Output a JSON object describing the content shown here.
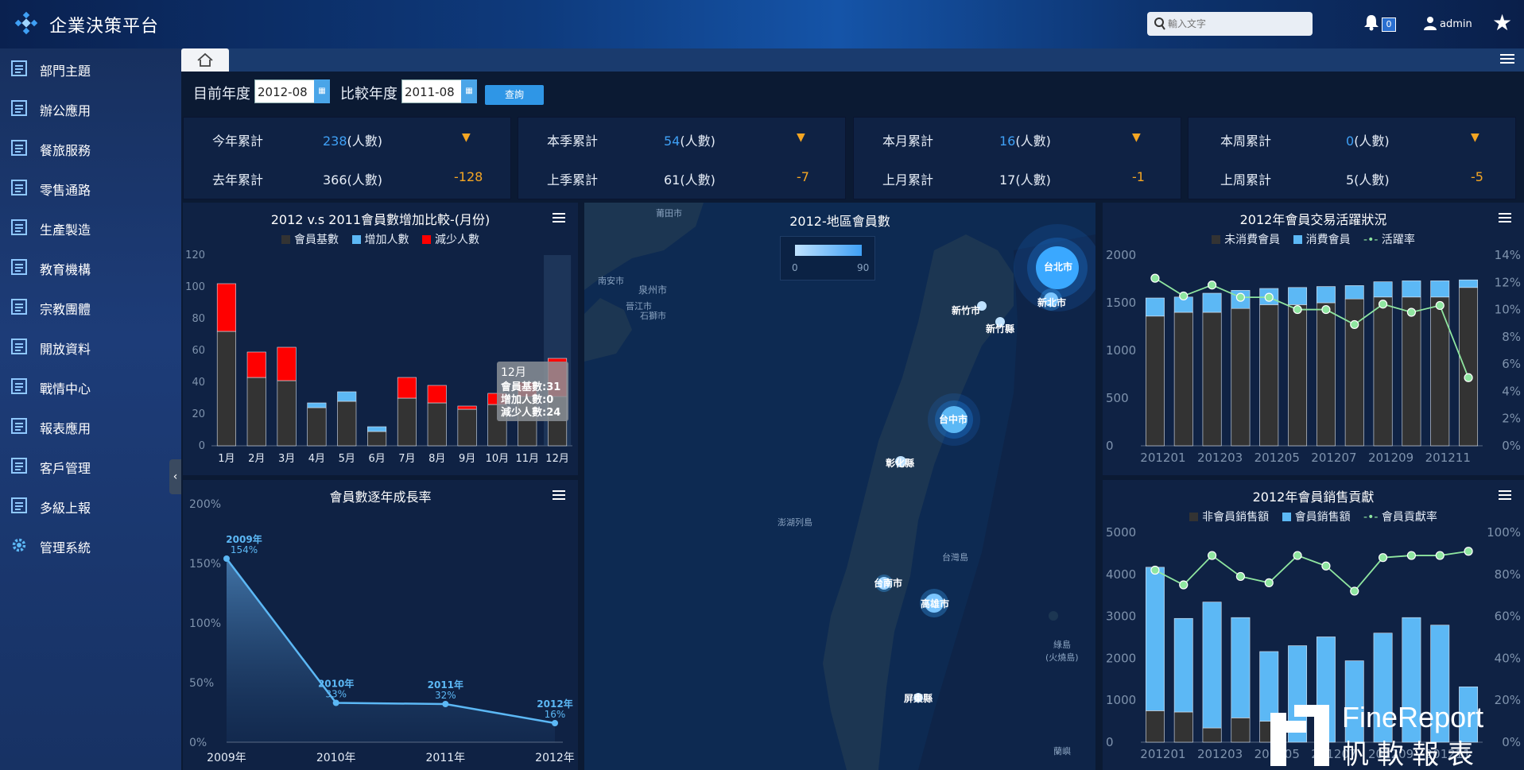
{
  "app": {
    "title": "企業決策平台"
  },
  "header": {
    "search_placeholder": "輸入文字",
    "notif_count": "0",
    "user": "admin"
  },
  "sidebar": {
    "items": [
      {
        "label": "部門主題"
      },
      {
        "label": "辦公應用"
      },
      {
        "label": "餐旅服務"
      },
      {
        "label": "零售通路"
      },
      {
        "label": "生產製造"
      },
      {
        "label": "教育機構"
      },
      {
        "label": "宗教團體"
      },
      {
        "label": "開放資料"
      },
      {
        "label": "戰情中心"
      },
      {
        "label": "報表應用"
      },
      {
        "label": "客戶管理"
      },
      {
        "label": "多級上報"
      },
      {
        "label": "管理系統"
      }
    ]
  },
  "filters": {
    "current_year_label": "目前年度",
    "current_year_value": "2012-08",
    "compare_year_label": "比較年度",
    "compare_year_value": "2011-08",
    "query_label": "查詢"
  },
  "kpis": [
    {
      "label1": "今年累計",
      "value1": "238",
      "unit": "(人數)",
      "label2": "去年累計",
      "value2": "366(人數)",
      "diff": "-128"
    },
    {
      "label1": "本季累計",
      "value1": "54",
      "unit": "(人數)",
      "label2": "上季累計",
      "value2": "61(人數)",
      "diff": "-7"
    },
    {
      "label1": "本月累計",
      "value1": "16",
      "unit": "(人數)",
      "label2": "上月累計",
      "value2": "17(人數)",
      "diff": "-1"
    },
    {
      "label1": "本周累計",
      "value1": "0",
      "unit": "(人數)",
      "label2": "上周累計",
      "value2": "5(人數)",
      "diff": "-5"
    }
  ],
  "colors": {
    "dark_bar": "#333333",
    "blue": "#5cb8f5",
    "red": "#ff0000",
    "line_green": "#8fe6a0",
    "accent": "#3fa0f5",
    "orange": "#f5a623"
  },
  "chart_data": [
    {
      "type": "bar",
      "title": "2012 v.s 2011會員數增加比較-(月份)",
      "categories": [
        "1月",
        "2月",
        "3月",
        "4月",
        "5月",
        "6月",
        "7月",
        "8月",
        "9月",
        "10月",
        "11月",
        "12月"
      ],
      "series": [
        {
          "name": "會員基數",
          "values": [
            72,
            43,
            41,
            24,
            28,
            9,
            30,
            27,
            23,
            26,
            31,
            31
          ]
        },
        {
          "name": "增加人數",
          "values": [
            0,
            0,
            0,
            3,
            6,
            3,
            0,
            0,
            0,
            0,
            0,
            0
          ]
        },
        {
          "name": "減少人數",
          "values": [
            30,
            16,
            21,
            0,
            0,
            0,
            13,
            11,
            2,
            7,
            9,
            24
          ]
        }
      ],
      "ylim": [
        0,
        120
      ],
      "yticks": [
        "0",
        "20",
        "40",
        "60",
        "80",
        "100",
        "120"
      ],
      "tooltip": {
        "title": "12月",
        "lines": [
          "會員基數:31",
          "增加人數:0",
          "減少人數:24"
        ]
      }
    },
    {
      "type": "area",
      "title": "會員數逐年成長率",
      "categories": [
        "2009年",
        "2010年",
        "2011年",
        "2012年"
      ],
      "values": [
        154,
        33,
        32,
        16
      ],
      "data_labels": [
        "154%",
        "33%",
        "32%",
        "16%"
      ],
      "ylim": [
        0,
        200
      ],
      "yticks": [
        "0%",
        "50%",
        "100%",
        "150%",
        "200%"
      ]
    },
    {
      "type": "bar",
      "title": "2012年會員交易活躍狀況",
      "categories": [
        "201201",
        "201202",
        "201203",
        "201204",
        "201205",
        "201206",
        "201207",
        "201208",
        "201209",
        "201210",
        "201211",
        "201212"
      ],
      "xticks": [
        "201201",
        "201203",
        "201205",
        "201207",
        "201209",
        "201211"
      ],
      "series": [
        {
          "name": "未消費會員",
          "values": [
            1360,
            1400,
            1400,
            1440,
            1480,
            1480,
            1500,
            1540,
            1560,
            1560,
            1560,
            1660
          ]
        },
        {
          "name": "消費會員",
          "values": [
            190,
            160,
            200,
            190,
            170,
            180,
            170,
            140,
            160,
            170,
            170,
            80
          ]
        },
        {
          "name": "活躍率",
          "values": [
            12.3,
            11.0,
            11.8,
            10.9,
            10.9,
            10.0,
            10.0,
            8.9,
            10.4,
            9.8,
            10.3,
            5.0
          ]
        }
      ],
      "ylim": [
        0,
        2000
      ],
      "y2lim": [
        0,
        14
      ],
      "yticks": [
        "0",
        "500",
        "1000",
        "1500",
        "2000"
      ],
      "y2ticks": [
        "0%",
        "2%",
        "4%",
        "6%",
        "8%",
        "10%",
        "12%",
        "14%"
      ]
    },
    {
      "type": "bar",
      "title": "2012年會員銷售貢獻",
      "categories": [
        "201201",
        "201202",
        "201203",
        "201204",
        "201205",
        "201206",
        "201207",
        "201208",
        "201209",
        "201210",
        "201211",
        "201212"
      ],
      "xticks": [
        "201201",
        "201203",
        "201205",
        "201207",
        "201209",
        "201211"
      ],
      "series": [
        {
          "name": "非會員銷售額",
          "values": [
            750,
            720,
            340,
            580,
            500,
            0,
            0,
            0,
            0,
            0,
            0,
            0
          ]
        },
        {
          "name": "會員銷售額",
          "values": [
            3420,
            2230,
            3000,
            2390,
            1660,
            2300,
            2510,
            1940,
            2600,
            2970,
            2790,
            1320
          ]
        },
        {
          "name": "會員貢獻率",
          "values": [
            82,
            75,
            89,
            79,
            76,
            89,
            84,
            72,
            88,
            89,
            89,
            91
          ]
        }
      ],
      "ylim": [
        0,
        5000
      ],
      "y2lim": [
        0,
        100
      ],
      "yticks": [
        "0",
        "1000",
        "2000",
        "3000",
        "4000",
        "5000"
      ],
      "y2ticks": [
        "0%",
        "20%",
        "40%",
        "60%",
        "80%",
        "100%"
      ]
    }
  ],
  "map": {
    "title": "2012-地區會員數",
    "range_min": "0",
    "range_max": "90",
    "cities": [
      "台北市",
      "新北市",
      "新竹市",
      "新竹縣",
      "台中市",
      "彰化縣",
      "台南市",
      "高雄市",
      "屏東縣"
    ],
    "places": [
      "莆田市",
      "南安市",
      "泉州市",
      "晉江市",
      "石獅市",
      "澎湖列島",
      "台灣島",
      "綠島",
      "(火燒島)",
      "蘭嶼"
    ]
  },
  "watermark": {
    "line1": "FineReport",
    "line2": "帆軟報表"
  }
}
